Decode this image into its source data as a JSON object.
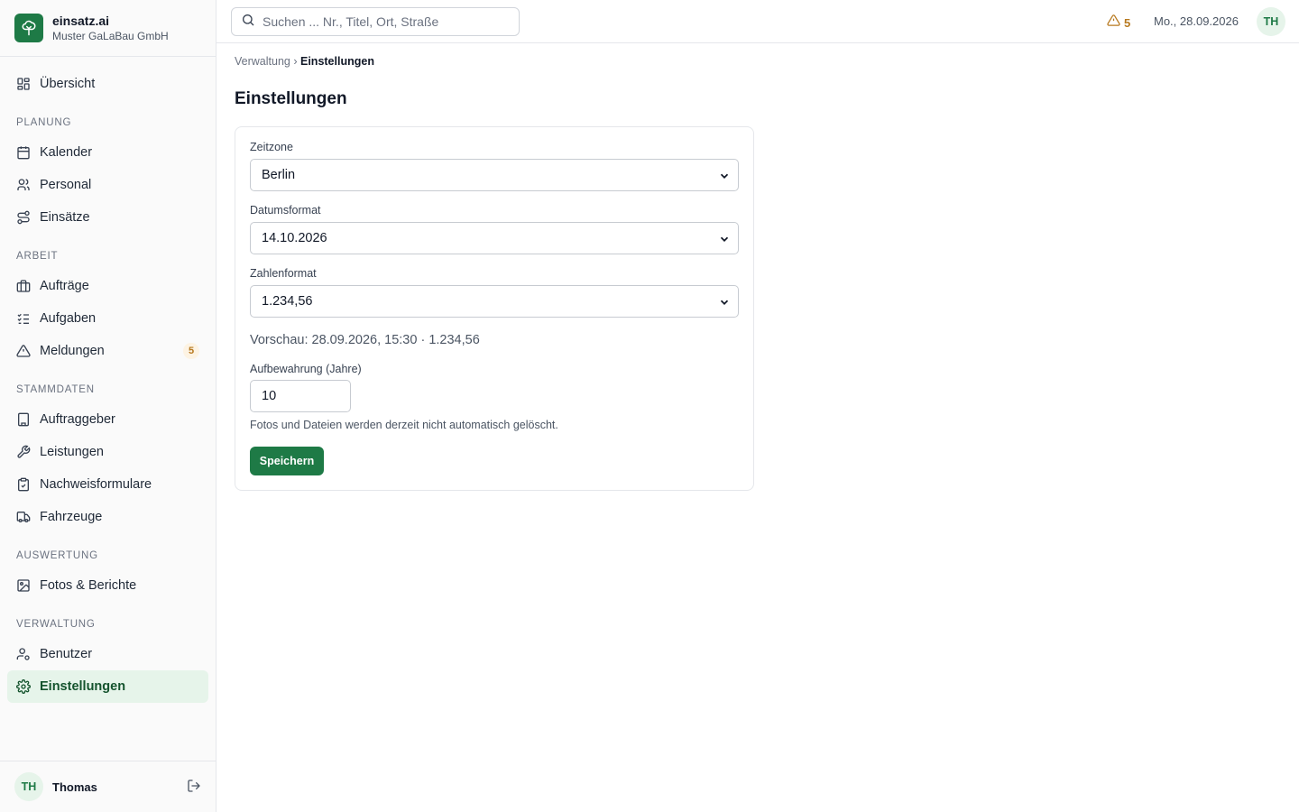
{
  "brand": {
    "name": "einsatz.ai",
    "org": "Muster GaLaBau GmbH"
  },
  "sidebar": {
    "overview": "Übersicht",
    "sections": {
      "planung": "PLANUNG",
      "arbeit": "ARBEIT",
      "stammdaten": "STAMMDATEN",
      "auswertung": "AUSWERTUNG",
      "verwaltung": "VERWALTUNG"
    },
    "items": {
      "kalender": "Kalender",
      "personal": "Personal",
      "einsaetze": "Einsätze",
      "auftraege": "Aufträge",
      "aufgaben": "Aufgaben",
      "meldungen": "Meldungen",
      "meldungen_badge": "5",
      "auftraggeber": "Auftraggeber",
      "leistungen": "Leistungen",
      "nachweisformulare": "Nachweisformulare",
      "fahrzeuge": "Fahrzeuge",
      "fotos": "Fotos & Berichte",
      "benutzer": "Benutzer",
      "einstellungen": "Einstellungen"
    },
    "active": "einstellungen",
    "user": {
      "initials": "TH",
      "name": "Thomas"
    }
  },
  "topbar": {
    "search_placeholder": "Suchen ... Nr., Titel, Ort, Straße",
    "alert_count": "5",
    "date": "Mo., 28.09.2026",
    "avatar_initials": "TH"
  },
  "breadcrumb": {
    "parent": "Verwaltung",
    "separator": "›",
    "current": "Einstellungen"
  },
  "page": {
    "title": "Einstellungen"
  },
  "form": {
    "timezone": {
      "label": "Zeitzone",
      "value": "Berlin"
    },
    "date_format": {
      "label": "Datumsformat",
      "value": "14.10.2026"
    },
    "number_format": {
      "label": "Zahlenformat",
      "value": "1.234,56"
    },
    "preview": "Vorschau: 28.09.2026, 15:30 · 1.234,56",
    "retention": {
      "label": "Aufbewahrung (Jahre)",
      "value": "10"
    },
    "hint": "Fotos und Dateien werden derzeit nicht automatisch gelöscht.",
    "save_label": "Speichern"
  },
  "colors": {
    "accent": "#1e7a46",
    "active_bg": "#e6f4ea",
    "warning": "#b7791f"
  }
}
